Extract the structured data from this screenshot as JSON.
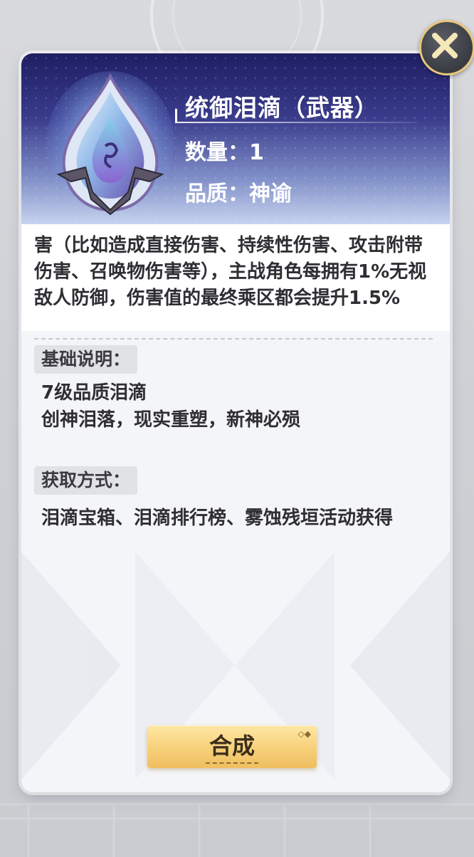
{
  "item": {
    "name": "统御泪滴（武器）",
    "quantity_text": "数量：1",
    "quality_text": "品质：神谕",
    "icon": "teardrop-crystal-icon"
  },
  "description": {
    "text": "害（比如造成直接伤害、持续性伤害、攻击附带伤害、召唤物伤害等），主战角色每拥有1%无视敌人防御，伤害值的最终乘区都会提升1.5%"
  },
  "basic": {
    "label": "基础说明：",
    "line1": "7级品质泪滴",
    "line2": "创神泪落，现实重塑，新神必殒"
  },
  "obtain": {
    "label": "获取方式：",
    "text": "泪滴宝箱、泪滴排行榜、雾蚀残垣活动获得"
  },
  "actions": {
    "compose_label": "合成",
    "close_icon": "close-icon"
  },
  "colors": {
    "header_dark": "#1f1e63",
    "button_gold": "#f7d07a",
    "close_ring": "#e9c77a"
  }
}
